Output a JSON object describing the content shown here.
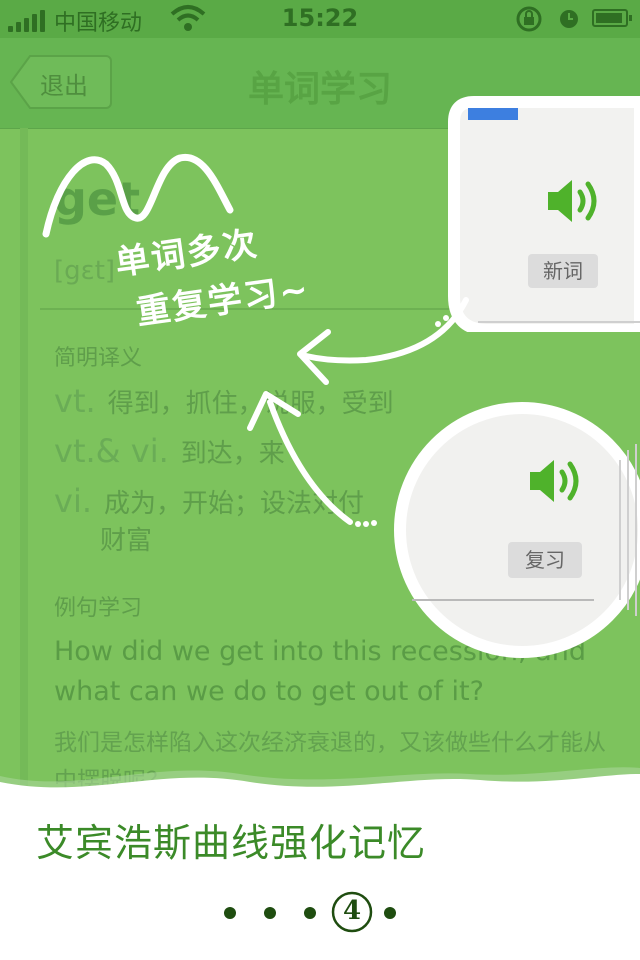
{
  "status_bar": {
    "carrier": "中国移动",
    "time": "15:22"
  },
  "nav": {
    "back_label": "退出",
    "title": "单词学习"
  },
  "word": {
    "text": "get",
    "phonetic": "[gɛt]"
  },
  "definitions": {
    "label": "简明译义",
    "items": [
      {
        "pos": "vt.",
        "text": "得到，抓住，说服，受到"
      },
      {
        "pos": "vt.& vi.",
        "text": "到达，来"
      },
      {
        "pos": "vi.",
        "text": "成为，开始；设法对付",
        "line2": "财富"
      }
    ]
  },
  "example": {
    "label": "例句学习",
    "en": "How did we get into this recession, and what can we do to get out of it?",
    "cn": "我们是怎样陷入这次经济衰退的，又该做些什么才能从中摆脱呢？"
  },
  "callouts": {
    "new_word_label": "新词",
    "review_label": "复习"
  },
  "handwritten": {
    "line1": "单词多次",
    "line2": "重复学习~"
  },
  "caption": "艾宾浩斯曲线强化记忆",
  "pager": {
    "current": "4"
  },
  "colors": {
    "green_bg": "#7dc35d",
    "caption_green": "#3b8a28",
    "dot": "#1f4d10"
  }
}
